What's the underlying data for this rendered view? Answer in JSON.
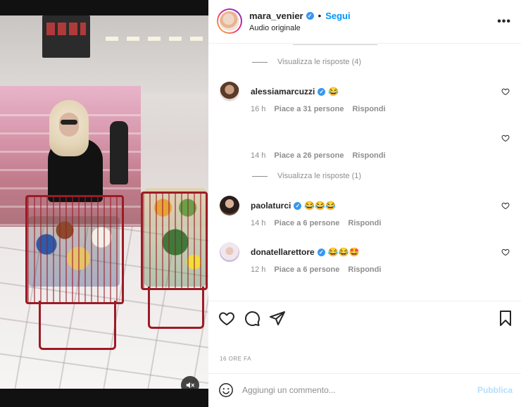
{
  "header": {
    "username": "mara_venier",
    "dot": "•",
    "follow_label": "Segui",
    "subtitle": "Audio originale",
    "more_label": "•••"
  },
  "colors": {
    "accent": "#0095f6",
    "verified": "#3897f0",
    "cart": "#9b1c26",
    "publish_disabled": "#b2dffc"
  },
  "replies": [
    {
      "label": "Visualizza le risposte (4)"
    },
    {
      "label": "Visualizza le risposte (1)"
    }
  ],
  "comments": [
    {
      "user": "alessiamarcuzzi",
      "text": "😂",
      "time": "16 h",
      "likes": "Piace a 31 persone",
      "reply": "Rispondi"
    },
    {
      "user": "",
      "text": "",
      "time": "14 h",
      "likes": "Piace a 26 persone",
      "reply": "Rispondi"
    },
    {
      "user": "paolaturci",
      "text": "😂😂😂",
      "time": "14 h",
      "likes": "Piace a 6 persone",
      "reply": "Rispondi"
    },
    {
      "user": "donatellarettore",
      "text": "😂😂🤩",
      "time": "12 h",
      "likes": "Piace a 6 persone",
      "reply": "Rispondi"
    }
  ],
  "icons": {
    "like": "heart-icon",
    "comment": "comment-icon",
    "share": "send-icon",
    "save": "bookmark-icon",
    "emoji": "smiley-icon",
    "mute": "mute-icon",
    "more": "more-icon"
  },
  "time_ago": "16 ORE FA",
  "add_comment": {
    "placeholder": "Aggiungi un commento...",
    "publish_label": "Pubblica"
  }
}
